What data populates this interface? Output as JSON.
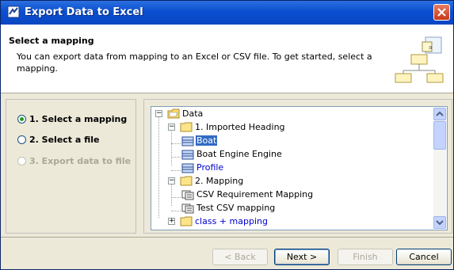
{
  "window": {
    "title": "Export Data to Excel"
  },
  "header": {
    "title": "Select a mapping",
    "description": "You can export data from mapping to an Excel or CSV file. To get started, select a mapping."
  },
  "steps": [
    {
      "label": "1. Select a mapping",
      "state": "current"
    },
    {
      "label": "2. Select a file",
      "state": "enabled"
    },
    {
      "label": "3. Export data to file",
      "state": "disabled"
    }
  ],
  "tree": {
    "nodes": [
      {
        "label": "Data"
      },
      {
        "label": "1. Imported Heading"
      },
      {
        "label": "Boat",
        "selected": true
      },
      {
        "label": "Boat Engine Engine"
      },
      {
        "label": "Profile"
      },
      {
        "label": "2. Mapping"
      },
      {
        "label": "CSV Requirement Mapping"
      },
      {
        "label": "Test CSV mapping"
      },
      {
        "label": "class + mapping"
      }
    ]
  },
  "buttons": {
    "back": "< Back",
    "next": "Next >",
    "finish": "Finish",
    "cancel": "Cancel"
  },
  "icons": {
    "window": "excel-export-icon",
    "header": "mapping-diagram-icon",
    "close": "close-icon"
  }
}
